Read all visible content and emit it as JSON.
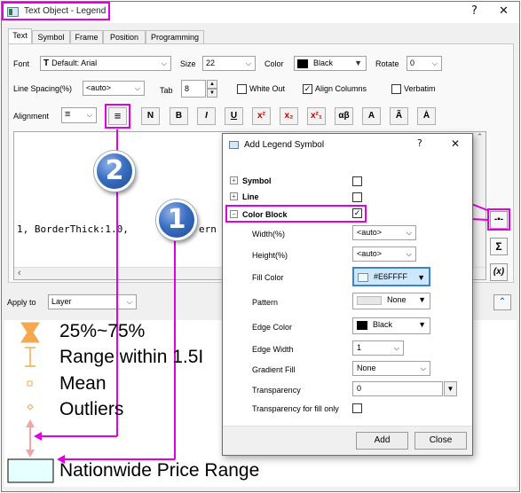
{
  "window": {
    "title": "Text Object - Legend",
    "help_label": "?",
    "close_label": "✕"
  },
  "tabs": [
    "Text",
    "Symbol",
    "Frame",
    "Position",
    "Programming"
  ],
  "toolbar": {
    "font_label": "Font",
    "font_value": "Default: Arial",
    "size_label": "Size",
    "size_value": "22",
    "color_label": "Color",
    "color_value": "Black",
    "rotate_label": "Rotate",
    "rotate_value": "0",
    "line_spacing_label": "Line Spacing(%)",
    "line_spacing_value": "<auto>",
    "tab_label": "Tab",
    "tab_value": "8",
    "white_out_label": "White Out",
    "align_columns_label": "Align Columns",
    "verbatim_label": "Verbatim",
    "alignment_label": "Alignment",
    "format_buttons": [
      "N",
      "B",
      "I",
      "U",
      "x²",
      "x₂",
      "x²₁",
      "αβ",
      "A",
      "Ã",
      "Ȧ"
    ]
  },
  "editor": {
    "text_fragment": "1, BorderThick:1.0,",
    "text_fragment2": "ern"
  },
  "apply_to": {
    "label": "Apply to",
    "value": "Layer"
  },
  "side_buttons": {
    "sigma": "Σ",
    "fx": "(x)"
  },
  "legend": {
    "items": [
      "25%~75%",
      "Range within 1.5I",
      "Mean",
      "Outliers",
      "Nationwide Price Range"
    ]
  },
  "badges": [
    "2",
    "1"
  ],
  "dialog": {
    "title": "Add Legend Symbol",
    "help_label": "?",
    "close_label": "✕",
    "sections": [
      "Symbol",
      "Line",
      "Color Block"
    ],
    "fields": [
      {
        "label": "Width(%)",
        "value": "<auto>"
      },
      {
        "label": "Height(%)",
        "value": "<auto>"
      },
      {
        "label": "Fill Color",
        "value": "#E6FFFF"
      },
      {
        "label": "Pattern",
        "value": "None"
      },
      {
        "label": "Edge Color",
        "value": "Black"
      },
      {
        "label": "Edge Width",
        "value": "1"
      },
      {
        "label": "Gradient Fill",
        "value": "None"
      },
      {
        "label": "Transparency",
        "value": "0"
      },
      {
        "label": "Transparency for fill only",
        "value": ""
      }
    ],
    "add_label": "Add",
    "close_btn_label": "Close"
  },
  "colors": {
    "highlight": "#e000e0",
    "fill_color": "#E6FFFF",
    "legend_orange": "#f5a94e",
    "legend_pink": "#f2a5a5",
    "dialog_fill_sel": "#cce8ff"
  }
}
